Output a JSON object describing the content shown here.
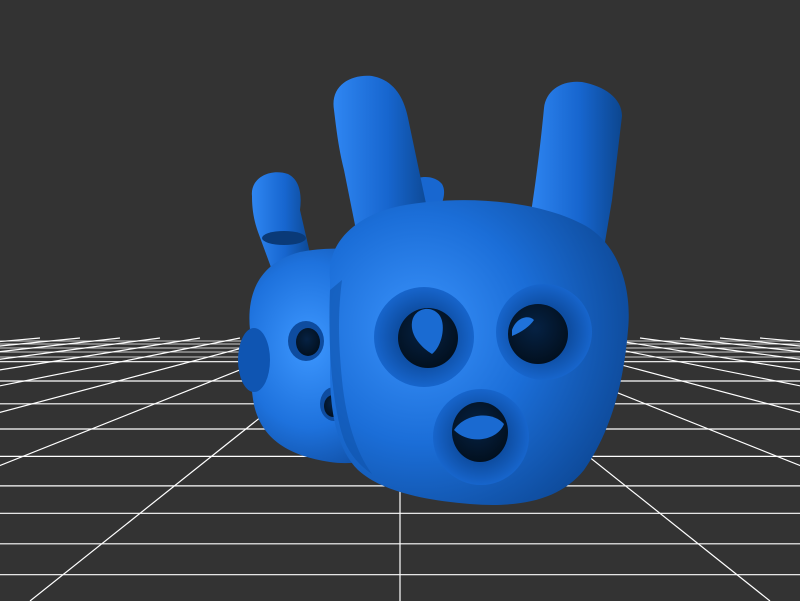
{
  "viewport": {
    "background_color": "#333333",
    "grid_color": "#ffffff",
    "model_color": "#1a6fd6",
    "model_highlight_color": "#3d97ff",
    "model_shadow_color": "#0b3f86",
    "hole_color": "#031428"
  },
  "scene": {
    "objects": [
      {
        "name": "rear-bunny-figure"
      },
      {
        "name": "front-bunny-figure"
      }
    ]
  }
}
